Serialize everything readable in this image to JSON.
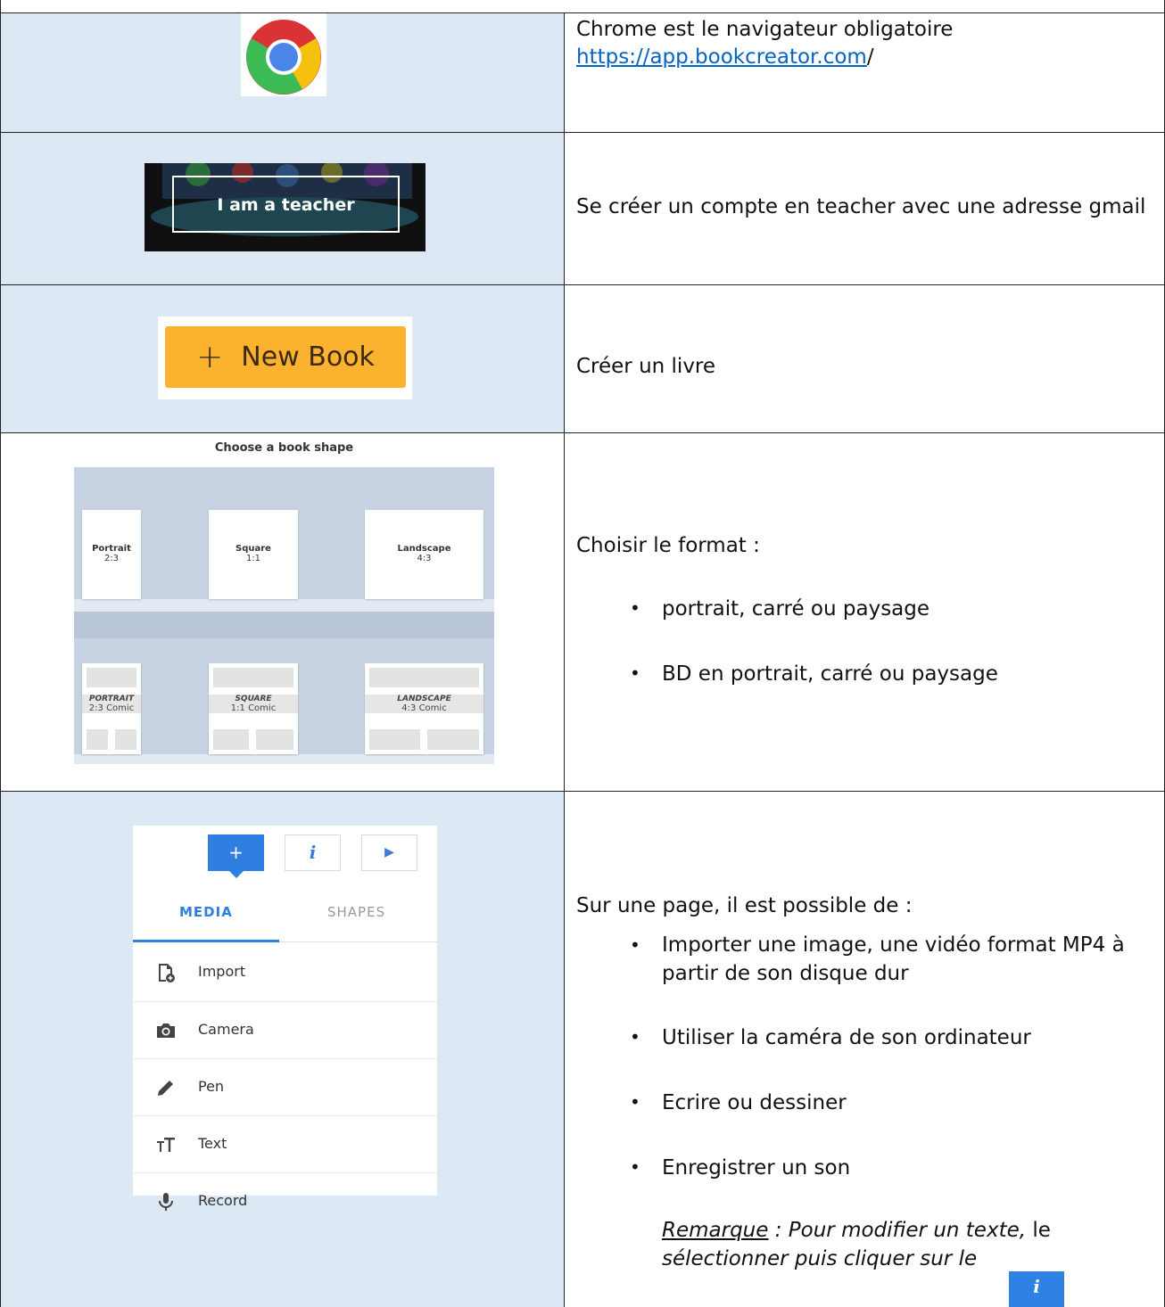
{
  "rows": [
    {
      "id": "chrome",
      "text_main": "Chrome est le navigateur obligatoire",
      "link": "https://app.bookcreator.com",
      "link_suffix": "/"
    },
    {
      "id": "account",
      "image_button": "I am a teacher",
      "text_main": "Se créer un compte en teacher avec une adresse gmail"
    },
    {
      "id": "newbook",
      "image_button": "New Book",
      "text_main": "Créer un livre"
    },
    {
      "id": "format",
      "image_title": "Choose a book shape",
      "shapes": [
        {
          "name": "Portrait",
          "ratio": "2:3"
        },
        {
          "name": "Square",
          "ratio": "1:1"
        },
        {
          "name": "Landscape",
          "ratio": "4:3"
        }
      ],
      "comics": [
        {
          "name": "PORTRAIT",
          "ratio": "2:3 Comic"
        },
        {
          "name": "SQUARE",
          "ratio": "1:1 Comic"
        },
        {
          "name": "LANDSCAPE",
          "ratio": "4:3 Comic"
        }
      ],
      "text_main": "Choisir le format :",
      "bullets": [
        "portrait, carré ou paysage",
        "BD en portrait, carré ou paysage"
      ]
    },
    {
      "id": "page",
      "toolbar": {
        "add": "+",
        "info": "i",
        "play": "▶"
      },
      "tabs": [
        "MEDIA",
        "SHAPES"
      ],
      "menu_items": [
        "Import",
        "Camera",
        "Pen",
        "Text",
        "Record"
      ],
      "text_main": "Sur une page, il est possible de :",
      "bullets": [
        "Importer une image, une vidéo format MP4 à partir de son disque dur",
        "Utiliser la caméra de son ordinateur",
        "Ecrire ou dessiner",
        "Enregistrer un son"
      ],
      "remark_label": "Remarque",
      "remark_text1": " : Pour modifier un texte,",
      "remark_text2": " le",
      "remark_line2": "sélectionner puis cliquer sur le",
      "remark_badge": "i"
    }
  ],
  "colors": {
    "cell_background": "#dce8f4",
    "link": "#0563c1",
    "new_book": "#fbb22f",
    "accent_blue": "#2f7fe0"
  }
}
